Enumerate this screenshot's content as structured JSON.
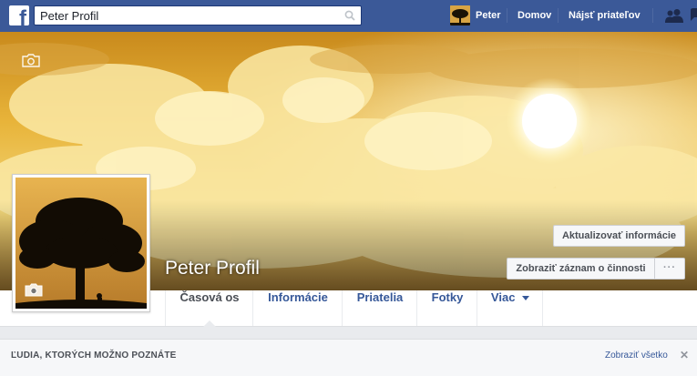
{
  "topbar": {
    "search_value": "Peter Profil",
    "user_name": "Peter",
    "home_label": "Domov",
    "find_friends_label": "Nájsť priateľov",
    "color": "#3b5998"
  },
  "profile": {
    "name": "Peter Profil",
    "update_info_label": "Aktualizovať informácie",
    "activity_log_label": "Zobraziť záznam o činnosti",
    "more_label": "···"
  },
  "tabs": [
    {
      "label": "Časová os",
      "active": true
    },
    {
      "label": "Informácie"
    },
    {
      "label": "Priatelia"
    },
    {
      "label": "Fotky"
    },
    {
      "label": "Viac"
    }
  ],
  "pymk": {
    "title": "ĽUDIA, KTORÝCH MOŽNO POZNÁTE",
    "see_all_label": "Zobraziť všetko",
    "close_label": "✕"
  },
  "icons": [
    "facebook-logo-icon",
    "search-icon",
    "friend-requests-icon",
    "camera-icon",
    "dropdown-caret-icon"
  ]
}
